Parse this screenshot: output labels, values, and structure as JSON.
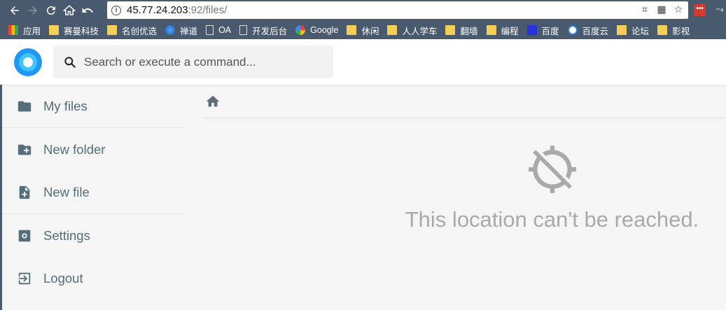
{
  "browser": {
    "url_host": "45.77.24.203",
    "url_rest": ":92/files/",
    "bookmarks": [
      {
        "label": "应用",
        "icon": "apps-icon"
      },
      {
        "label": "赛曼科技",
        "icon": "folder-icon"
      },
      {
        "label": "名创优选",
        "icon": "folder-icon"
      },
      {
        "label": "禅道",
        "icon": "globe-icon"
      },
      {
        "label": "OA",
        "icon": "page-icon"
      },
      {
        "label": "开发后台",
        "icon": "page-icon"
      },
      {
        "label": "Google",
        "icon": "google-icon"
      },
      {
        "label": "休闲",
        "icon": "folder-icon"
      },
      {
        "label": "人人学车",
        "icon": "folder-icon"
      },
      {
        "label": "翻墙",
        "icon": "folder-icon"
      },
      {
        "label": "编程",
        "icon": "folder-icon"
      },
      {
        "label": "百度",
        "icon": "baidu-icon"
      },
      {
        "label": "百度云",
        "icon": "baidu-cloud-icon"
      },
      {
        "label": "论坛",
        "icon": "folder-icon"
      },
      {
        "label": "影视",
        "icon": "folder-icon"
      }
    ]
  },
  "header": {
    "search_placeholder": "Search or execute a command..."
  },
  "sidebar": {
    "items": [
      {
        "label": "My files"
      },
      {
        "label": "New folder"
      },
      {
        "label": "New file"
      },
      {
        "label": "Settings"
      },
      {
        "label": "Logout"
      }
    ]
  },
  "main": {
    "error_message": "This location can't be reached."
  },
  "colors": {
    "chrome": "#4a5a6e",
    "accent": "#2196f3",
    "sidebar_text": "#546e7a",
    "error_text": "#a9a9a9"
  }
}
